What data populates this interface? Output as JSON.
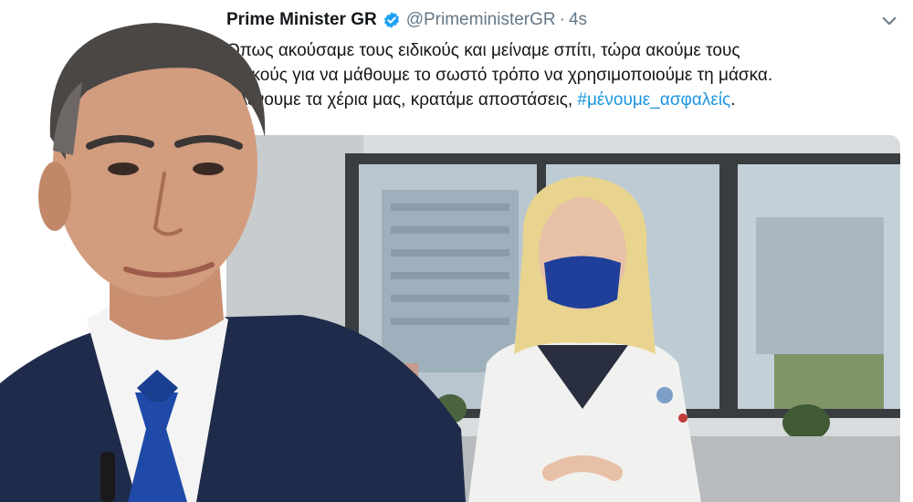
{
  "tweet": {
    "display_name": "Prime Minister GR",
    "verified_icon": "verified-badge-icon",
    "handle": "@PrimeministerGR",
    "separator": "·",
    "time": "4s",
    "text_lines": [
      "Όπως ακούσαμε τους ειδικούς και μείναμε σπίτι, τώρα ακούμε τους",
      "ειδικούς για να μάθουμε το σωστό τρόπο να χρησιμοποιούμε τη μάσκα.",
      "Πλένουμε τα χέρια μας, κρατάμε αποστάσεις,"
    ],
    "hashtag": "#μένουμε_ασφαλείς",
    "trailing": "."
  },
  "colors": {
    "text": "#14171a",
    "muted": "#657786",
    "link": "#1b95e0",
    "verified": "#1da1f2",
    "mask": "#1f3f9a"
  },
  "icons": {
    "caret": "chevron-down-icon"
  }
}
